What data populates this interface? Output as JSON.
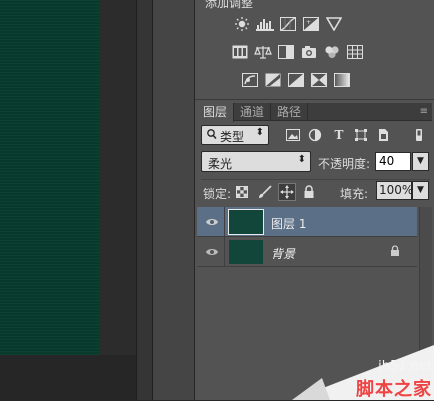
{
  "adjustments": {
    "title": "添加调整",
    "rows": [
      [
        "brightness-contrast-icon",
        "levels-icon",
        "curves-icon",
        "exposure-icon",
        "vibrance-icon"
      ],
      [
        "hue-saturation-icon",
        "color-balance-icon",
        "black-white-icon",
        "photo-filter-icon",
        "channel-mixer-icon",
        "color-lookup-icon"
      ],
      [
        "invert-icon",
        "posterize-icon",
        "threshold-icon",
        "selective-color-icon",
        "gradient-map-icon"
      ]
    ]
  },
  "layers_panel": {
    "tabs": [
      {
        "label": "图层",
        "active": true
      },
      {
        "label": "通道",
        "active": false
      },
      {
        "label": "路径",
        "active": false
      }
    ],
    "menu_icon": "panel-menu-icon",
    "filter": {
      "kind_label": "类型",
      "icons": [
        "pixel-filter-icon",
        "adjustment-filter-icon",
        "type-filter-icon",
        "shape-filter-icon",
        "smart-object-filter-icon"
      ]
    },
    "blend_mode": "柔光",
    "opacity_label": "不透明度:",
    "opacity_value": "40",
    "lock_label": "锁定:",
    "lock_icons": [
      "lock-transparent-icon",
      "lock-image-icon",
      "lock-position-icon",
      "lock-all-icon"
    ],
    "fill_label": "填充:",
    "fill_value": "100%",
    "layers": [
      {
        "name": "图层 1",
        "selected": true,
        "visible": true,
        "locked": false,
        "thumb_color": "#13463a"
      },
      {
        "name": "背景",
        "selected": false,
        "visible": true,
        "locked": true,
        "thumb_color": "#13463a"
      }
    ]
  },
  "watermark": {
    "url": "jb51.net",
    "brand": "脚本之家"
  },
  "colors": {
    "canvas": "#083a2c",
    "panel": "#535353",
    "selection": "#5b6f87",
    "watermark_brand": "#e44444"
  }
}
